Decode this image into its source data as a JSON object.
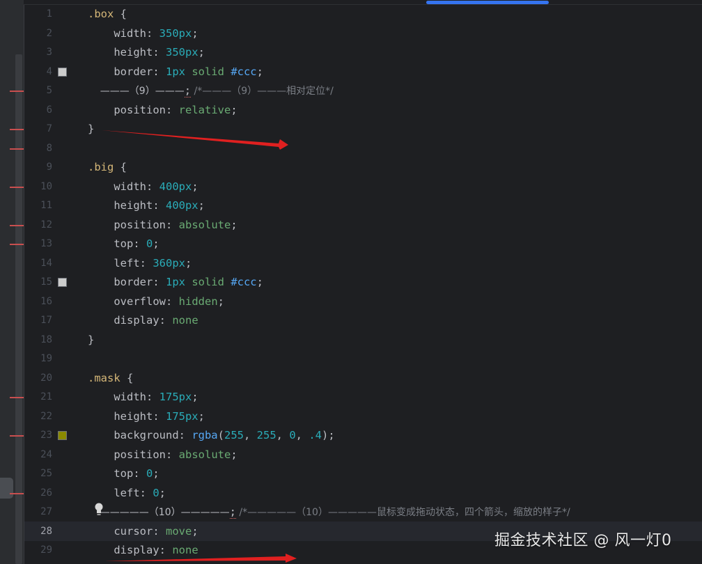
{
  "editor": {
    "active_line": 28,
    "lines": [
      {
        "n": "1",
        "tokens": [
          {
            "c": "sel",
            "t": ".box"
          },
          {
            "c": "prop",
            "t": " {"
          }
        ]
      },
      {
        "n": "2",
        "tokens": [
          {
            "c": "prop",
            "t": "    width: "
          },
          {
            "c": "num",
            "t": "350px"
          },
          {
            "c": "prop",
            "t": ";"
          }
        ]
      },
      {
        "n": "3",
        "tokens": [
          {
            "c": "prop",
            "t": "    height: "
          },
          {
            "c": "num",
            "t": "350px"
          },
          {
            "c": "prop",
            "t": ";"
          }
        ]
      },
      {
        "n": "4",
        "tokens": [
          {
            "c": "prop",
            "t": "    border: "
          },
          {
            "c": "num",
            "t": "1px"
          },
          {
            "c": "val",
            "t": " solid "
          },
          {
            "c": "hex",
            "t": "#ccc"
          },
          {
            "c": "prop",
            "t": ";"
          }
        ]
      },
      {
        "n": "5",
        "tokens": [
          {
            "c": "dash",
            "t": "    ———（9）———"
          },
          {
            "c": "prop squig",
            "t": ";"
          },
          {
            "c": "cmt",
            "t": " /*———（9）———相对定位*/"
          }
        ]
      },
      {
        "n": "6",
        "tokens": [
          {
            "c": "prop",
            "t": "    position: "
          },
          {
            "c": "val",
            "t": "relative"
          },
          {
            "c": "prop",
            "t": ";"
          }
        ]
      },
      {
        "n": "7",
        "tokens": [
          {
            "c": "prop",
            "t": "}"
          }
        ]
      },
      {
        "n": "8",
        "tokens": []
      },
      {
        "n": "9",
        "tokens": [
          {
            "c": "sel",
            "t": ".big"
          },
          {
            "c": "prop",
            "t": " {"
          }
        ]
      },
      {
        "n": "10",
        "tokens": [
          {
            "c": "prop",
            "t": "    width: "
          },
          {
            "c": "num",
            "t": "400px"
          },
          {
            "c": "prop",
            "t": ";"
          }
        ]
      },
      {
        "n": "11",
        "tokens": [
          {
            "c": "prop",
            "t": "    height: "
          },
          {
            "c": "num",
            "t": "400px"
          },
          {
            "c": "prop",
            "t": ";"
          }
        ]
      },
      {
        "n": "12",
        "tokens": [
          {
            "c": "prop",
            "t": "    position: "
          },
          {
            "c": "val",
            "t": "absolute"
          },
          {
            "c": "prop",
            "t": ";"
          }
        ]
      },
      {
        "n": "13",
        "tokens": [
          {
            "c": "prop",
            "t": "    top: "
          },
          {
            "c": "num",
            "t": "0"
          },
          {
            "c": "prop",
            "t": ";"
          }
        ]
      },
      {
        "n": "14",
        "tokens": [
          {
            "c": "prop",
            "t": "    left: "
          },
          {
            "c": "num",
            "t": "360px"
          },
          {
            "c": "prop",
            "t": ";"
          }
        ]
      },
      {
        "n": "15",
        "tokens": [
          {
            "c": "prop",
            "t": "    border: "
          },
          {
            "c": "num",
            "t": "1px"
          },
          {
            "c": "val",
            "t": " solid "
          },
          {
            "c": "hex",
            "t": "#ccc"
          },
          {
            "c": "prop",
            "t": ";"
          }
        ]
      },
      {
        "n": "16",
        "tokens": [
          {
            "c": "prop",
            "t": "    overflow: "
          },
          {
            "c": "val",
            "t": "hidden"
          },
          {
            "c": "prop",
            "t": ";"
          }
        ]
      },
      {
        "n": "17",
        "tokens": [
          {
            "c": "prop",
            "t": "    display: "
          },
          {
            "c": "val",
            "t": "none"
          }
        ]
      },
      {
        "n": "18",
        "tokens": [
          {
            "c": "prop",
            "t": "}"
          }
        ]
      },
      {
        "n": "19",
        "tokens": []
      },
      {
        "n": "20",
        "tokens": [
          {
            "c": "sel",
            "t": ".mask"
          },
          {
            "c": "prop",
            "t": " {"
          }
        ]
      },
      {
        "n": "21",
        "tokens": [
          {
            "c": "prop",
            "t": "    width: "
          },
          {
            "c": "num",
            "t": "175px"
          },
          {
            "c": "prop",
            "t": ";"
          }
        ]
      },
      {
        "n": "22",
        "tokens": [
          {
            "c": "prop",
            "t": "    height: "
          },
          {
            "c": "num",
            "t": "175px"
          },
          {
            "c": "prop",
            "t": ";"
          }
        ]
      },
      {
        "n": "23",
        "tokens": [
          {
            "c": "prop",
            "t": "    background: "
          },
          {
            "c": "fn",
            "t": "rgba"
          },
          {
            "c": "prop",
            "t": "("
          },
          {
            "c": "num",
            "t": "255"
          },
          {
            "c": "prop",
            "t": ", "
          },
          {
            "c": "num",
            "t": "255"
          },
          {
            "c": "prop",
            "t": ", "
          },
          {
            "c": "num",
            "t": "0"
          },
          {
            "c": "prop",
            "t": ", "
          },
          {
            "c": "num",
            "t": ".4"
          },
          {
            "c": "prop",
            "t": ");"
          }
        ]
      },
      {
        "n": "24",
        "tokens": [
          {
            "c": "prop",
            "t": "    position: "
          },
          {
            "c": "val",
            "t": "absolute"
          },
          {
            "c": "prop",
            "t": ";"
          }
        ]
      },
      {
        "n": "25",
        "tokens": [
          {
            "c": "prop",
            "t": "    top: "
          },
          {
            "c": "num",
            "t": "0"
          },
          {
            "c": "prop",
            "t": ";"
          }
        ]
      },
      {
        "n": "26",
        "tokens": [
          {
            "c": "prop",
            "t": "    left: "
          },
          {
            "c": "num",
            "t": "0"
          },
          {
            "c": "prop",
            "t": ";"
          }
        ]
      },
      {
        "n": "27",
        "tokens": [
          {
            "c": "dash",
            "t": "    —————（10）—————"
          },
          {
            "c": "prop squig",
            "t": ";"
          },
          {
            "c": "cmt",
            "t": " /*—————（10）—————鼠标变成拖动状态，四个箭头，缩放的样子*/"
          }
        ]
      },
      {
        "n": "28",
        "tokens": [
          {
            "c": "prop",
            "t": "    cursor: "
          },
          {
            "c": "val",
            "t": "move"
          },
          {
            "c": "prop",
            "t": ";"
          }
        ]
      },
      {
        "n": "29",
        "tokens": [
          {
            "c": "prop",
            "t": "    display: "
          },
          {
            "c": "val",
            "t": "none"
          }
        ]
      }
    ],
    "swatches": [
      {
        "line": 4,
        "color": "#cccccc"
      },
      {
        "line": 15,
        "color": "#cccccc"
      },
      {
        "line": 23,
        "color": "#8a8a00"
      }
    ],
    "error_marks": [
      5,
      7,
      8,
      10,
      12,
      13,
      21,
      23,
      26
    ],
    "annotation_color": "#e02020"
  },
  "watermark": {
    "text": "掘金技术社区 @ 风一灯0"
  }
}
